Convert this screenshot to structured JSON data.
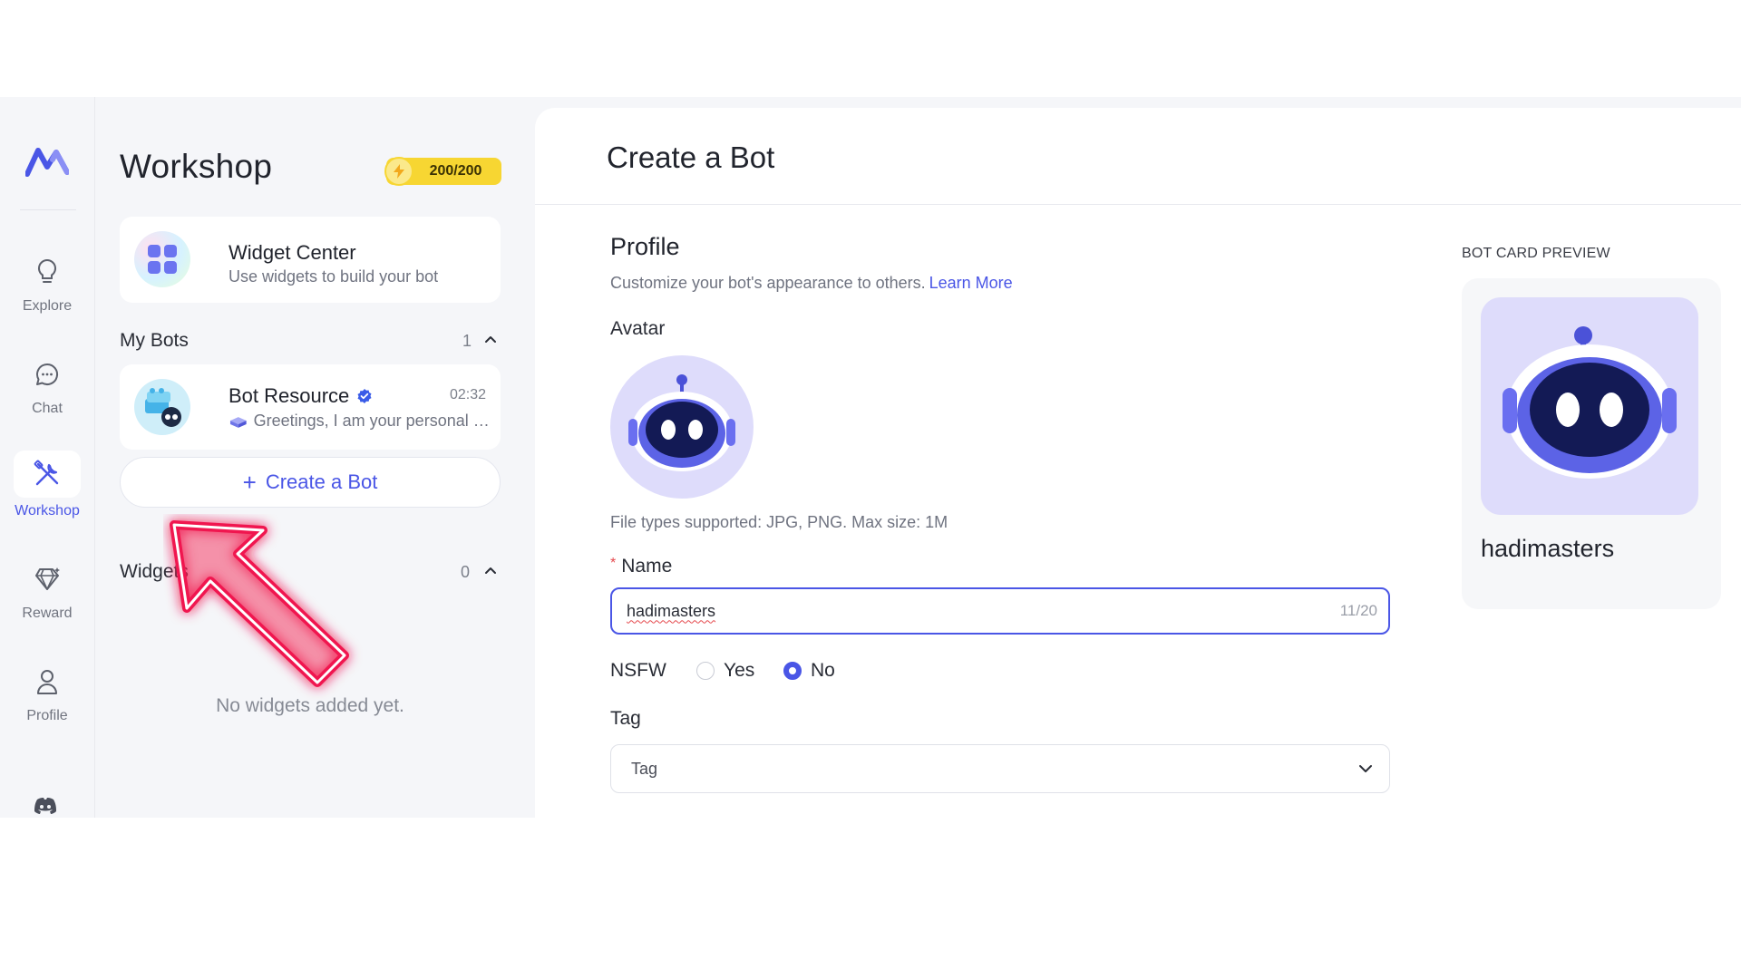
{
  "rail": {
    "items": [
      {
        "label": "Explore",
        "icon": "bulb-icon"
      },
      {
        "label": "Chat",
        "icon": "chat-bubble-icon"
      },
      {
        "label": "Workshop",
        "icon": "tools-icon"
      },
      {
        "label": "Reward",
        "icon": "diamond-icon"
      },
      {
        "label": "Profile",
        "icon": "person-icon"
      }
    ],
    "active": "Workshop",
    "accent": "#4a56e6"
  },
  "panel": {
    "title": "Workshop",
    "energy": "200/200",
    "widget_center": {
      "title": "Widget Center",
      "subtitle": "Use widgets to build your bot"
    },
    "my_bots": {
      "heading": "My Bots",
      "count": "1",
      "bots": [
        {
          "name": "Bot Resource",
          "time": "02:32",
          "message": "Greetings, I am your personal b..."
        }
      ]
    },
    "create_label": "Create a Bot",
    "widgets": {
      "heading": "Widgets",
      "count": "0",
      "empty": "No widgets added yet."
    }
  },
  "main": {
    "title": "Create a Bot",
    "profile": {
      "heading": "Profile",
      "description": "Customize your bot's appearance to others.",
      "learn_more": "Learn More",
      "avatar_label": "Avatar",
      "file_types": "File types supported: JPG, PNG. Max size: 1M"
    },
    "name": {
      "label": "Name",
      "value": "hadimasters",
      "counter": "11/20"
    },
    "nsfw": {
      "label": "NSFW",
      "options": [
        "Yes",
        "No"
      ],
      "selected": "No"
    },
    "tag": {
      "label": "Tag",
      "placeholder": "Tag"
    },
    "preview": {
      "heading": "BOT CARD PREVIEW",
      "name": "hadimasters"
    }
  }
}
